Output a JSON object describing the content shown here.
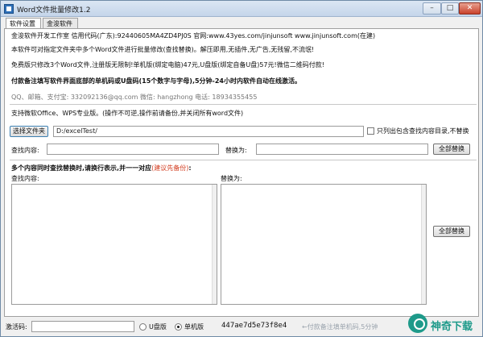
{
  "window": {
    "title": "Word文件批量修改1.2"
  },
  "tabs": [
    {
      "label": "软件设置"
    },
    {
      "label": "金浚软件"
    }
  ],
  "info": {
    "company": "金浚软件开发工作室  信用代码(广东):92440605MA4ZD4PJ0S  官网:www.43yes.com/jinjunsoft  www.jinjunsoft.com(在建)",
    "desc": "本软件可对指定文件夹中多个Word文件进行批量修改(查找替换)。解压即用,无插件,无广告,无残留,不流氓!",
    "pricing": "免费版只修改3个Word文件,注册版无限制!单机版(绑定电脑)47元,U盘版(绑定自备U盘)57元!微信二维码付款!",
    "payment_note": "付款备注填写软件界面底部的单机码或U盘码(15个数字与字母),5分钟-24小时内软件自动在线激活。",
    "contact": "QQ、邮箱、支付宝: 332092136@qq.com       微信: hangzhong    电话: 18934355455"
  },
  "support_note": "支持微软Office、WPS专业版。(操作不可逆,操作前请备份,并关闭所有word文件)",
  "folder": {
    "button_label": "选择文件夹",
    "path": "D:/excelTest/",
    "checkbox_label": "只列出包含查找内容目录,不替换"
  },
  "single_replace": {
    "find_label": "查找内容:",
    "replace_label": "替换为:",
    "button_label": "全部替换"
  },
  "multi_replace": {
    "title": "多个内容同时查找替换时,请换行表示,并一一对应",
    "title_suffix": ":",
    "backup_hint": "(建议先备份)",
    "find_label": "查找内容:",
    "replace_label": "替换为:",
    "button_label": "全部替换"
  },
  "status": {
    "activation_label": "激活码:",
    "radio_usb": "U盘版",
    "radio_pc": "单机版",
    "machine_code": "447ae7d5e73f8e4",
    "hint": "←付款备注填单机码,5分钟"
  },
  "watermark": {
    "text": "神奇下载"
  },
  "colors": {
    "accent": "#3c7fb1",
    "warning": "#d23b1e",
    "watermark": "#1e9a8a"
  }
}
